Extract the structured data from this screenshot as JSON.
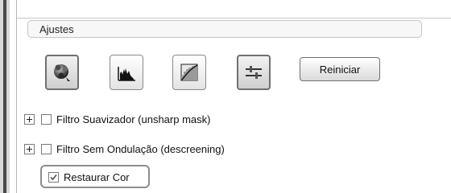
{
  "panel": {
    "group_title": "Ajustes",
    "tools": [
      {
        "icon": "color-balance-icon",
        "active": true
      },
      {
        "icon": "histogram-icon",
        "active": false
      },
      {
        "icon": "tone-curve-icon",
        "active": false
      },
      {
        "icon": "sliders-icon",
        "active": true
      }
    ],
    "reset_label": "Reiniciar",
    "options": [
      {
        "label": "Filtro Suavizador (unsharp mask)",
        "checked": false,
        "expandable": true
      },
      {
        "label": "Filtro Sem Ondulação (descreening)",
        "checked": false,
        "expandable": true
      },
      {
        "label": "Restaurar Cor",
        "checked": true,
        "expandable": false
      }
    ]
  }
}
